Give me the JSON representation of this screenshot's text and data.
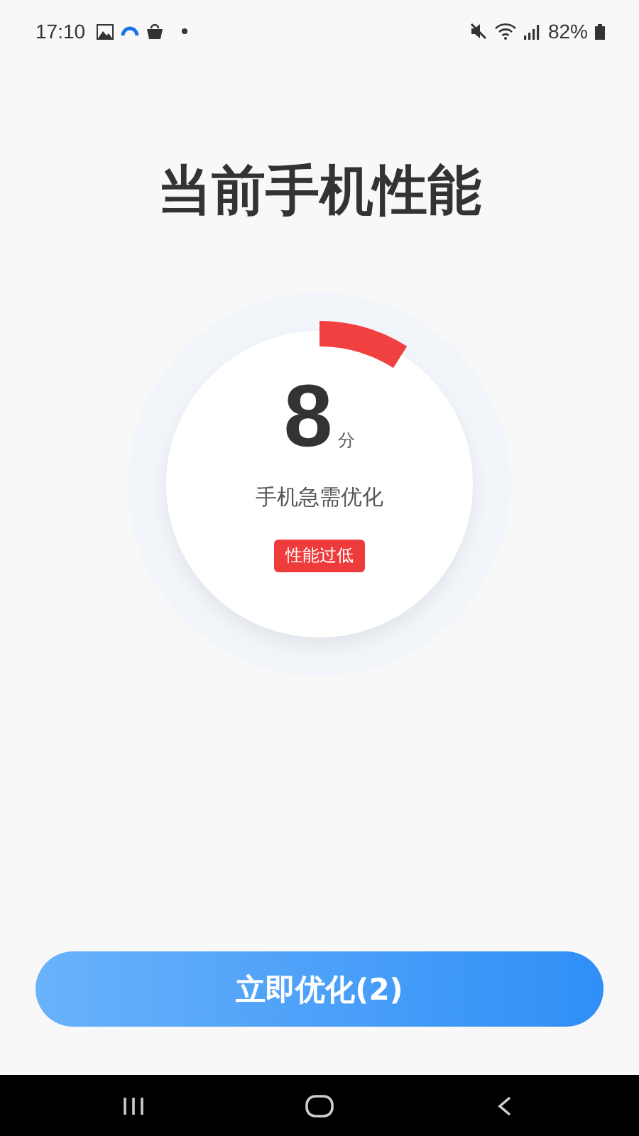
{
  "status_bar": {
    "time": "17:10",
    "battery": "82%"
  },
  "title": "当前手机性能",
  "gauge": {
    "score": "8",
    "unit": "分",
    "message": "手机急需优化",
    "badge": "性能过低"
  },
  "button": {
    "label": "立即优化(2)"
  }
}
